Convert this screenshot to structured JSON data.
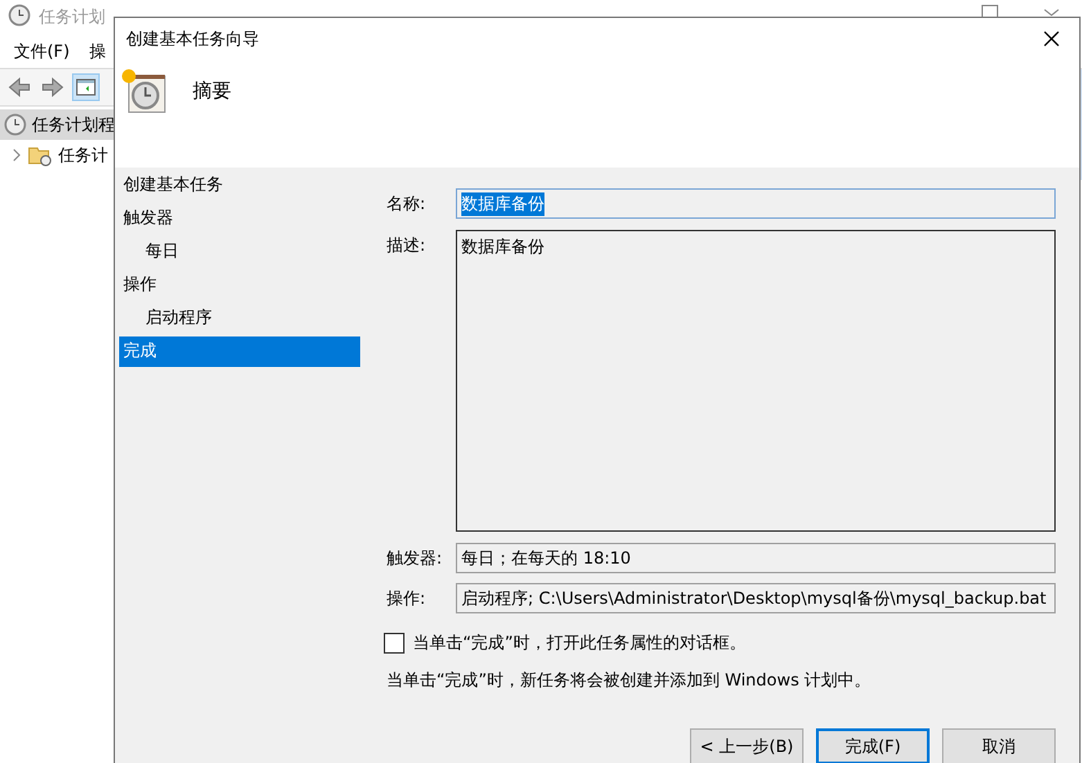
{
  "background_window": {
    "title": "任务计划",
    "menu": [
      "文件(F)",
      "操"
    ],
    "tree": [
      {
        "label": "任务计划程",
        "selected": true,
        "children": [
          {
            "label": "任务计",
            "expanded": false
          }
        ]
      }
    ]
  },
  "dialog": {
    "title": "创建基本任务向导",
    "heading": "摘要",
    "steps": [
      {
        "label": "创建基本任务",
        "kind": "top",
        "selected": false
      },
      {
        "label": "触发器",
        "kind": "top",
        "selected": false
      },
      {
        "label": "每日",
        "kind": "sub",
        "selected": false
      },
      {
        "label": "操作",
        "kind": "top",
        "selected": false
      },
      {
        "label": "启动程序",
        "kind": "sub",
        "selected": false
      },
      {
        "label": "完成",
        "kind": "top",
        "selected": true
      }
    ],
    "name": {
      "label": "名称:",
      "value": "数据库备份",
      "selected": true
    },
    "description": {
      "label": "描述:",
      "value": "数据库备份"
    },
    "trigger": {
      "label": "触发器:",
      "value": "每日；在每天的 18:10"
    },
    "action": {
      "label": "操作:",
      "value": "启动程序; C:\\Users\\Administrator\\Desktop\\mysql备份\\mysql_backup.bat"
    },
    "open_properties": {
      "label": "当单击“完成”时，打开此任务属性的对话框。",
      "checked": false
    },
    "note": "当单击“完成”时，新任务将会被创建并添加到 Windows 计划中。",
    "buttons": [
      {
        "label": "< 上一步(B)",
        "default": false
      },
      {
        "label": "完成(F)",
        "default": true
      },
      {
        "label": "取消",
        "default": false
      }
    ]
  }
}
